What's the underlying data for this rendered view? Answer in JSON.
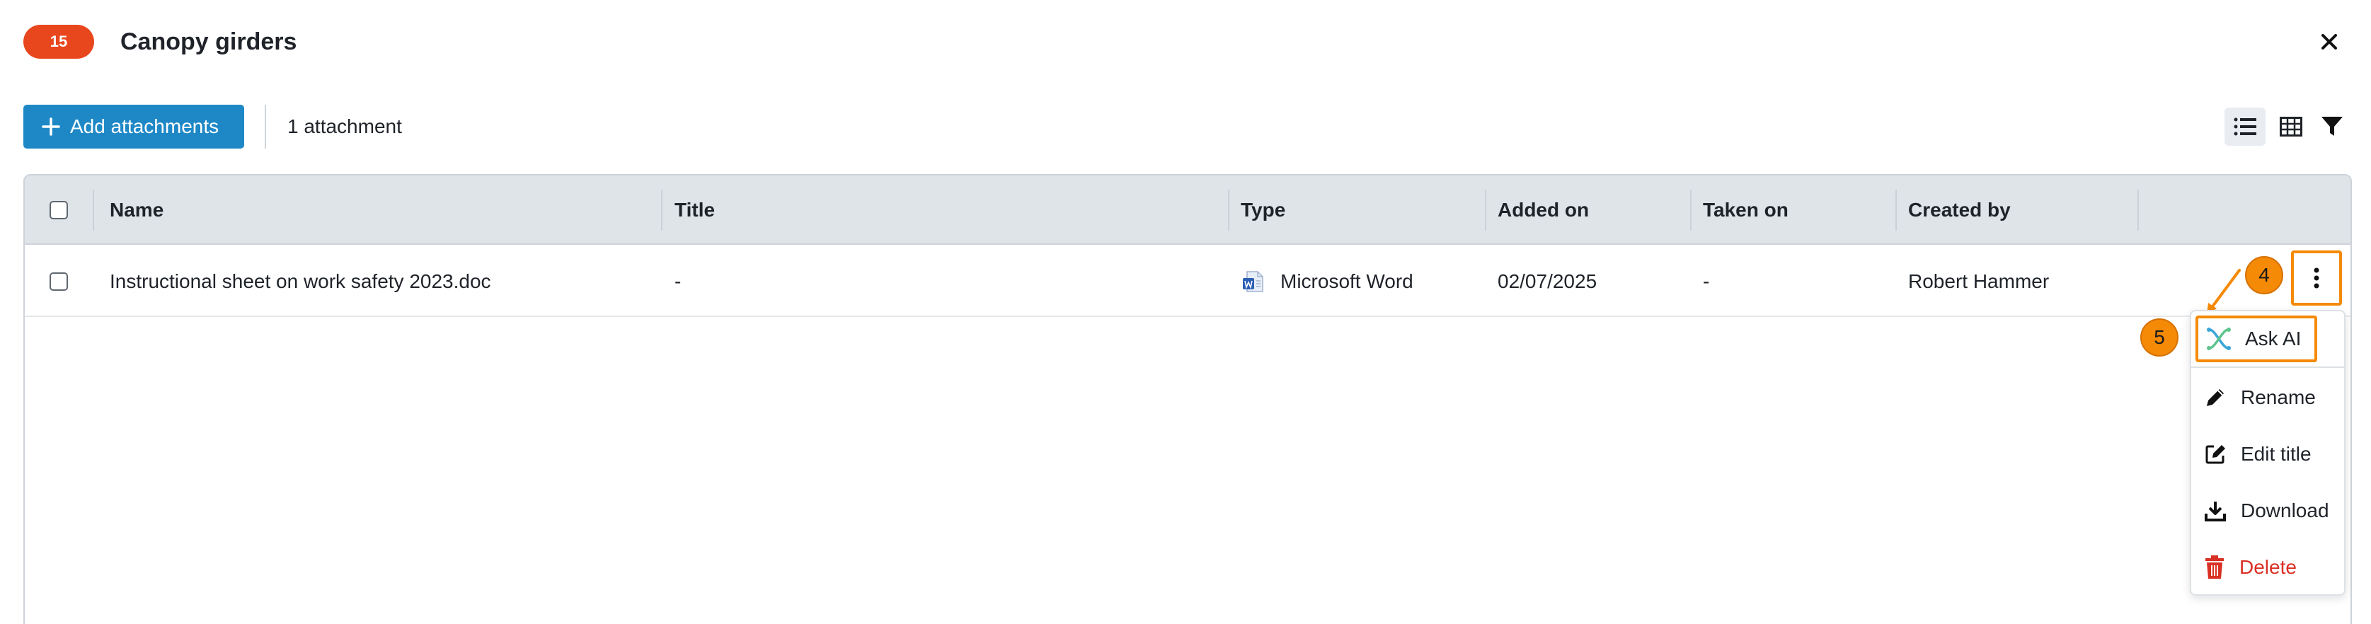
{
  "header": {
    "badge": "15",
    "title": "Canopy girders"
  },
  "toolbar": {
    "add_label": "Add attachments",
    "count_label": "1 attachment"
  },
  "table": {
    "columns": [
      "Name",
      "Title",
      "Type",
      "Added on",
      "Taken on",
      "Created by"
    ],
    "rows": [
      {
        "name": "Instructional sheet on work safety 2023.doc",
        "title": "-",
        "type": "Microsoft Word",
        "added_on": "02/07/2025",
        "taken_on": "-",
        "created_by": "Robert Hammer"
      }
    ]
  },
  "menu": {
    "items": [
      {
        "label": "Ask AI",
        "icon": "ai-icon"
      },
      {
        "label": "Rename",
        "icon": "pencil-icon"
      },
      {
        "label": "Edit title",
        "icon": "edit-square-icon"
      },
      {
        "label": "Download",
        "icon": "download-icon"
      },
      {
        "label": "Delete",
        "icon": "trash-icon"
      }
    ]
  },
  "callouts": [
    "4",
    "5"
  ],
  "colors": {
    "accent": "#1e88c7",
    "badge": "#e8461d",
    "highlight": "#f58a07",
    "danger": "#d93025"
  }
}
